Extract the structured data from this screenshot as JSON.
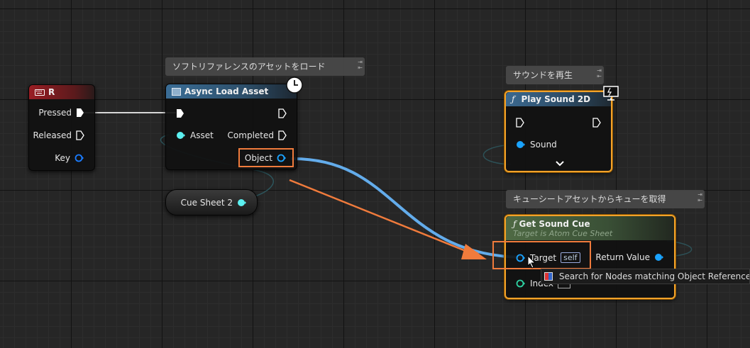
{
  "colors": {
    "exec_pin": "#ffffff",
    "object_pin": "#1aa3ff",
    "soft_ref_pin": "#5cf0f0",
    "integer_pin": "#2ed1a2",
    "wire_object": "#66b3f5",
    "annotation": "#f07b3c",
    "selection": "#f2a22a"
  },
  "input_event_node": {
    "title": "R",
    "icon": "keyboard-icon",
    "pins": {
      "pressed": "Pressed",
      "released": "Released",
      "key": "Key"
    }
  },
  "async_load_node": {
    "comment": "ソフトリファレンスのアセットをロード",
    "title": "Async Load Asset",
    "icon": "clock-icon",
    "pins": {
      "asset": "Asset",
      "completed": "Completed",
      "object": "Object"
    }
  },
  "cue_sheet_variable": {
    "label": "Cue Sheet 2"
  },
  "play_sound_node": {
    "comment": "サウンドを再生",
    "title": "Play Sound 2D",
    "pins": {
      "sound": "Sound"
    }
  },
  "get_sound_cue_node": {
    "comment": "キューシートアセットからキューを取得",
    "title": "Get Sound Cue",
    "subtitle": "Target is Atom Cue Sheet",
    "pins": {
      "target": "Target",
      "target_default": "self",
      "return_value": "Return Value",
      "index": "Index"
    }
  },
  "tooltip": {
    "text": "Search for Nodes matching Object Reference (O"
  }
}
